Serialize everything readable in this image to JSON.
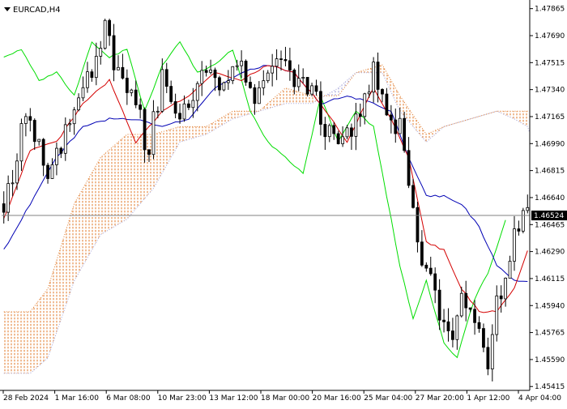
{
  "chart_data": {
    "type": "candlestick",
    "symbol_label": "EURCAD,H4",
    "current_price": "1.46524",
    "y_ticks": [
      "1.47865",
      "1.47690",
      "1.47515",
      "1.47340",
      "1.47165",
      "1.46990",
      "1.46815",
      "1.46640",
      "1.46465",
      "1.46290",
      "1.46115",
      "1.45940",
      "1.45765",
      "1.45590",
      "1.45415"
    ],
    "x_ticks": [
      "28 Feb 2024",
      "1 Mar 16:00",
      "6 Mar 08:00",
      "10 Mar 23:00",
      "13 Mar 12:00",
      "18 Mar 00:00",
      "20 Mar 16:00",
      "25 Mar 04:00",
      "27 Mar 20:00",
      "1 Apr 12:00",
      "4 Apr 04:00"
    ],
    "ylim": [
      1.4539,
      1.479
    ],
    "grid": false,
    "bar_count": 120,
    "close_anchors": [
      [
        0,
        1.466
      ],
      [
        5,
        1.4715
      ],
      [
        10,
        1.468
      ],
      [
        14,
        1.4705
      ],
      [
        19,
        1.474
      ],
      [
        23,
        1.477
      ],
      [
        26,
        1.4745
      ],
      [
        29,
        1.473
      ],
      [
        33,
        1.4695
      ],
      [
        36,
        1.4745
      ],
      [
        40,
        1.472
      ],
      [
        43,
        1.473
      ],
      [
        46,
        1.4745
      ],
      [
        50,
        1.473
      ],
      [
        53,
        1.4755
      ],
      [
        57,
        1.473
      ],
      [
        60,
        1.475
      ],
      [
        63,
        1.476
      ],
      [
        66,
        1.4735
      ],
      [
        70,
        1.474
      ],
      [
        73,
        1.471
      ],
      [
        76,
        1.4695
      ],
      [
        80,
        1.4715
      ],
      [
        84,
        1.4745
      ],
      [
        87,
        1.472
      ],
      [
        90,
        1.471
      ],
      [
        92,
        1.467
      ],
      [
        95,
        1.4625
      ],
      [
        98,
        1.46
      ],
      [
        101,
        1.457
      ],
      [
        104,
        1.46
      ],
      [
        107,
        1.458
      ],
      [
        110,
        1.4555
      ],
      [
        112,
        1.46
      ],
      [
        115,
        1.462
      ],
      [
        117,
        1.465
      ],
      [
        119,
        1.4652
      ]
    ],
    "tenkan_anchors": [
      [
        0,
        1.465
      ],
      [
        6,
        1.4695
      ],
      [
        12,
        1.47
      ],
      [
        18,
        1.4725
      ],
      [
        24,
        1.474
      ],
      [
        30,
        1.47
      ],
      [
        36,
        1.472
      ],
      [
        42,
        1.473
      ],
      [
        48,
        1.4745
      ],
      [
        54,
        1.474
      ],
      [
        60,
        1.475
      ],
      [
        66,
        1.4745
      ],
      [
        72,
        1.4725
      ],
      [
        78,
        1.47
      ],
      [
        84,
        1.4735
      ],
      [
        88,
        1.4715
      ],
      [
        92,
        1.469
      ],
      [
        96,
        1.4635
      ],
      [
        100,
        1.463
      ],
      [
        104,
        1.4605
      ],
      [
        108,
        1.459
      ],
      [
        112,
        1.459
      ],
      [
        116,
        1.4605
      ],
      [
        119,
        1.463
      ]
    ],
    "kijun_anchors": [
      [
        0,
        1.463
      ],
      [
        6,
        1.466
      ],
      [
        12,
        1.469
      ],
      [
        18,
        1.471
      ],
      [
        24,
        1.4715
      ],
      [
        30,
        1.4715
      ],
      [
        36,
        1.471
      ],
      [
        42,
        1.4715
      ],
      [
        48,
        1.4735
      ],
      [
        54,
        1.4745
      ],
      [
        60,
        1.475
      ],
      [
        66,
        1.4745
      ],
      [
        72,
        1.4725
      ],
      [
        78,
        1.473
      ],
      [
        84,
        1.4725
      ],
      [
        88,
        1.472
      ],
      [
        92,
        1.469
      ],
      [
        96,
        1.4665
      ],
      [
        100,
        1.4665
      ],
      [
        104,
        1.466
      ],
      [
        108,
        1.4645
      ],
      [
        112,
        1.462
      ],
      [
        116,
        1.461
      ],
      [
        119,
        1.461
      ]
    ],
    "chikou_anchors": [
      [
        0,
        1.4755
      ],
      [
        4,
        1.476
      ],
      [
        8,
        1.474
      ],
      [
        12,
        1.4745
      ],
      [
        16,
        1.473
      ],
      [
        20,
        1.4765
      ],
      [
        24,
        1.4755
      ],
      [
        28,
        1.476
      ],
      [
        32,
        1.472
      ],
      [
        36,
        1.475
      ],
      [
        40,
        1.4765
      ],
      [
        44,
        1.4745
      ],
      [
        48,
        1.475
      ],
      [
        52,
        1.476
      ],
      [
        56,
        1.472
      ],
      [
        60,
        1.47
      ],
      [
        64,
        1.469
      ],
      [
        68,
        1.468
      ],
      [
        72,
        1.473
      ],
      [
        76,
        1.47
      ],
      [
        80,
        1.472
      ],
      [
        84,
        1.471
      ],
      [
        88,
        1.465
      ],
      [
        90,
        1.462
      ],
      [
        93,
        1.4585
      ],
      [
        96,
        1.461
      ],
      [
        98,
        1.459
      ],
      [
        100,
        1.457
      ],
      [
        103,
        1.456
      ],
      [
        106,
        1.459
      ],
      [
        108,
        1.4605
      ],
      [
        110,
        1.4615
      ],
      [
        113,
        1.464
      ],
      [
        114,
        1.465
      ]
    ],
    "span_a_anchors": [
      [
        0,
        1.459
      ],
      [
        6,
        1.459
      ],
      [
        10,
        1.4605
      ],
      [
        16,
        1.466
      ],
      [
        22,
        1.469
      ],
      [
        28,
        1.4705
      ],
      [
        34,
        1.4705
      ],
      [
        40,
        1.471
      ],
      [
        46,
        1.471
      ],
      [
        52,
        1.472
      ],
      [
        58,
        1.472
      ],
      [
        64,
        1.4735
      ],
      [
        70,
        1.473
      ],
      [
        76,
        1.473
      ],
      [
        80,
        1.4745
      ],
      [
        86,
        1.475
      ],
      [
        90,
        1.473
      ],
      [
        96,
        1.4705
      ],
      [
        100,
        1.471
      ],
      [
        106,
        1.4715
      ],
      [
        112,
        1.472
      ],
      [
        116,
        1.472
      ],
      [
        119,
        1.472
      ],
      [
        124,
        1.472
      ],
      [
        128,
        1.472
      ]
    ],
    "span_b_anchors": [
      [
        0,
        1.455
      ],
      [
        6,
        1.455
      ],
      [
        10,
        1.456
      ],
      [
        16,
        1.461
      ],
      [
        22,
        1.464
      ],
      [
        28,
        1.465
      ],
      [
        34,
        1.467
      ],
      [
        40,
        1.47
      ],
      [
        46,
        1.4705
      ],
      [
        52,
        1.4715
      ],
      [
        58,
        1.472
      ],
      [
        64,
        1.4725
      ],
      [
        70,
        1.4725
      ],
      [
        76,
        1.4735
      ],
      [
        80,
        1.4745
      ],
      [
        86,
        1.4745
      ],
      [
        90,
        1.472
      ],
      [
        96,
        1.47
      ],
      [
        100,
        1.471
      ],
      [
        106,
        1.4715
      ],
      [
        112,
        1.472
      ],
      [
        116,
        1.4715
      ],
      [
        119,
        1.471
      ],
      [
        124,
        1.469
      ],
      [
        128,
        1.4665
      ]
    ],
    "colors": {
      "candle": "#000000",
      "tenkan": "#d40000",
      "kijun": "#0000b4",
      "chikou": "#00dd00",
      "cloud_up": "#e07a2a",
      "cloud_down": "#a0a0d8",
      "price_line": "#808080",
      "price_badge": "#000000"
    }
  }
}
